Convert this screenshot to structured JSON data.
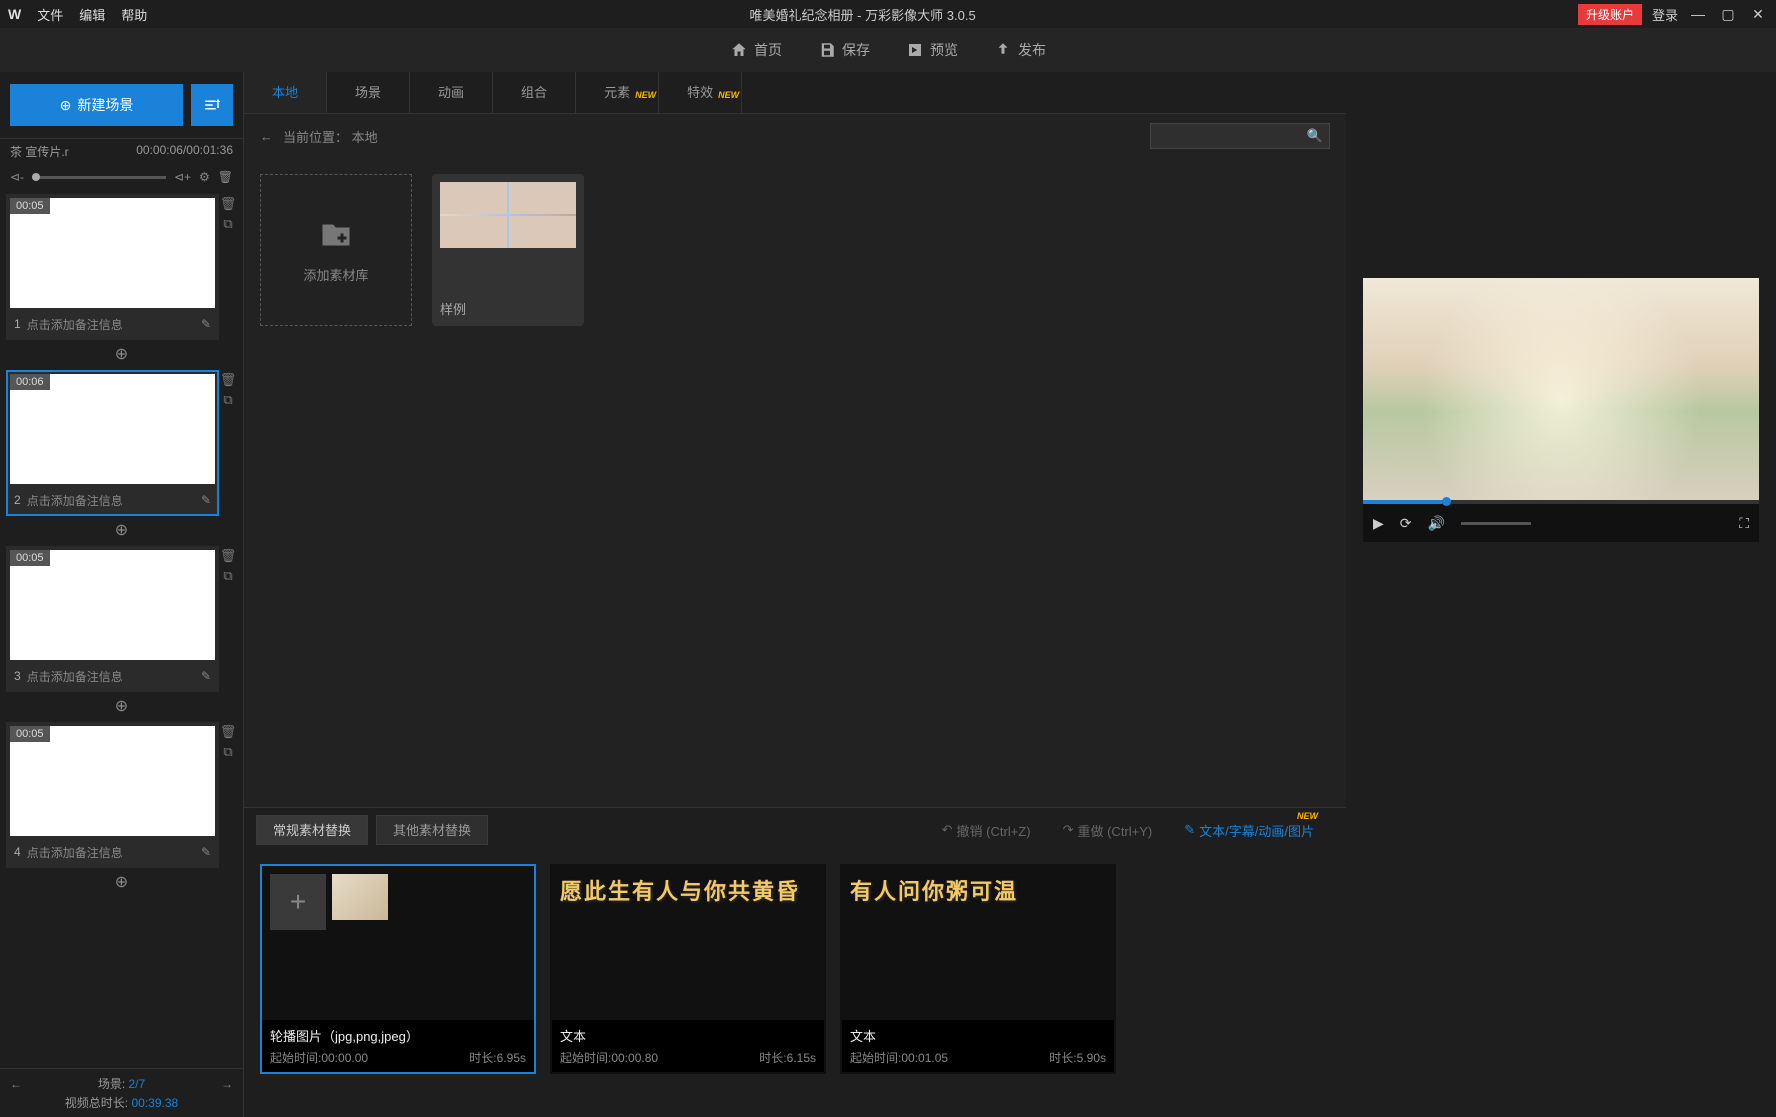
{
  "titlebar": {
    "menus": {
      "file": "文件",
      "edit": "编辑",
      "help": "帮助"
    },
    "project_name": "唯美婚礼纪念相册",
    "app_name": "万彩影像大师",
    "version": "3.0.5",
    "upgrade": "升级账户",
    "login": "登录"
  },
  "toolbar": {
    "home": "首页",
    "save": "保存",
    "preview": "预览",
    "publish": "发布"
  },
  "left": {
    "new_scene": "新建场景",
    "file_label": "茶 宣传片.r",
    "time_current": "00:00:06",
    "time_total": "00:01:36",
    "vol_down": "⊲-",
    "vol_up": "⊲+",
    "scenes": [
      {
        "idx": "1",
        "time": "00:05",
        "note": "点击添加备注信息",
        "selected": false
      },
      {
        "idx": "2",
        "time": "00:06",
        "note": "点击添加备注信息",
        "selected": true
      },
      {
        "idx": "3",
        "time": "00:05",
        "note": "点击添加备注信息",
        "selected": false
      },
      {
        "idx": "4",
        "time": "00:05",
        "note": "点击添加备注信息",
        "selected": false
      }
    ],
    "footer": {
      "scene_label": "场景:",
      "scene_pos": "2/7",
      "total_label": "视频总时长:",
      "total_time": "00:39.38"
    }
  },
  "center": {
    "tabs": [
      {
        "label": "本地",
        "active": true,
        "new": false
      },
      {
        "label": "场景",
        "active": false,
        "new": false
      },
      {
        "label": "动画",
        "active": false,
        "new": false
      },
      {
        "label": "组合",
        "active": false,
        "new": false
      },
      {
        "label": "元素",
        "active": false,
        "new": true
      },
      {
        "label": "特效",
        "active": false,
        "new": true
      }
    ],
    "loc_label": "当前位置：",
    "loc_value": "本地",
    "add_library": "添加素材库",
    "sample_folder": "样例"
  },
  "bottom": {
    "tabs": [
      {
        "label": "常规素材替换",
        "active": true
      },
      {
        "label": "其他素材替换",
        "active": false
      }
    ],
    "undo": "撤销 (Ctrl+Z)",
    "redo": "重做 (Ctrl+Y)",
    "text_anim": "文本/字幕/动画/图片",
    "new_label": "NEW",
    "items": [
      {
        "title": "轮播图片（jpg,png,jpeg）",
        "start_label": "起始时间:",
        "start": "00:00.00",
        "dur_label": "时长:",
        "dur": "6.95s",
        "selected": true,
        "type": "carousel"
      },
      {
        "title": "文本",
        "start_label": "起始时间:",
        "start": "00:00.80",
        "dur_label": "时长:",
        "dur": "6.15s",
        "selected": false,
        "type": "text",
        "preview": "愿此生有人与你共黄昏"
      },
      {
        "title": "文本",
        "start_label": "起始时间:",
        "start": "00:01.05",
        "dur_label": "时长:",
        "dur": "5.90s",
        "selected": false,
        "type": "text",
        "preview": "有人问你粥可温"
      }
    ]
  },
  "preview": {
    "progress_pct": 20
  }
}
